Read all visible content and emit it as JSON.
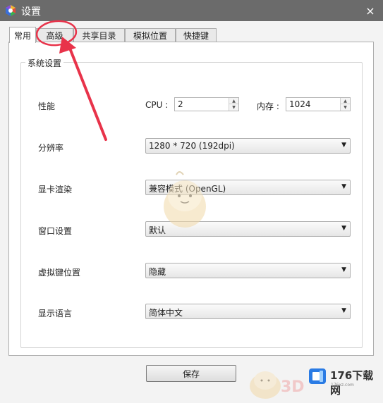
{
  "window": {
    "title": "设置",
    "close_icon": "×"
  },
  "tabs": [
    {
      "label": "常用",
      "active": true
    },
    {
      "label": "高级",
      "active": false
    },
    {
      "label": "共享目录",
      "active": false
    },
    {
      "label": "模拟位置",
      "active": false
    },
    {
      "label": "快捷键",
      "active": false
    }
  ],
  "group": {
    "title": "系统设置"
  },
  "performance": {
    "label": "性能",
    "cpu_label": "CPU :",
    "cpu_value": "2",
    "memory_label": "内存 :",
    "memory_value": "1024"
  },
  "resolution": {
    "label": "分辨率",
    "value": "1280 * 720 (192dpi)"
  },
  "graphics": {
    "label": "显卡渲染",
    "value": "兼容模式 (OpenGL)"
  },
  "window_setting": {
    "label": "窗口设置",
    "value": "默认"
  },
  "virtual_keys": {
    "label": "虚拟键位置",
    "value": "隐藏"
  },
  "language": {
    "label": "显示语言",
    "value": "简体中文"
  },
  "save_button": {
    "label": "保存"
  },
  "watermark": {
    "logo_text": "176下载网",
    "logo_sub": "176xz.com",
    "mark_3d": "3D"
  },
  "colors": {
    "titlebar": "#6b6b6b",
    "annotation": "#e8334a"
  }
}
